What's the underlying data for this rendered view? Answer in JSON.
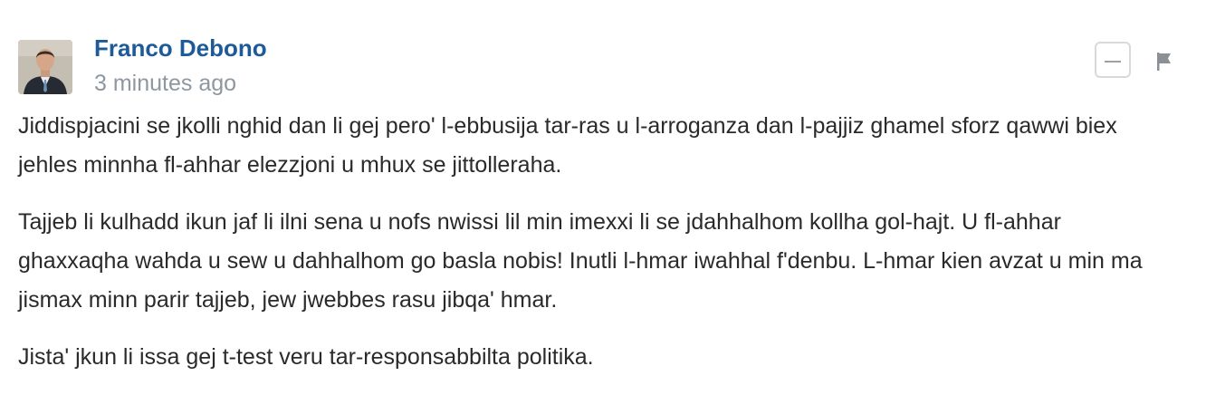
{
  "comment": {
    "author": "Franco Debono",
    "timestamp": "3 minutes ago",
    "paragraphs": [
      "Jiddispjacini se jkolli nghid dan li gej pero' l-ebbusija tar-ras u l-arroganza dan l-pajjiz ghamel sforz qawwi biex jehles minnha fl-ahhar elezzjoni u mhux se jittolleraha.",
      "Tajjeb li kulhadd ikun jaf li ilni sena u nofs nwissi lil min imexxi li se jdahhalhom kollha gol-hajt. U fl-ahhar ghaxxaqha wahda u sew u dahhalhom go basla nobis! Inutli l-hmar iwahhal f'denbu. L-hmar kien avzat u min ma jismax minn parir tajjeb, jew jwebbes rasu jibqa' hmar.",
      "Jista' jkun li issa gej t-test veru tar-responsabbilta politika."
    ]
  },
  "icons": {
    "avatar": "user-avatar-photo",
    "collapse": "minus-icon",
    "flag": "flag-icon"
  },
  "colors": {
    "author": "#1d5a9a",
    "timestamp": "#8e979f",
    "text": "#2a2a2a"
  }
}
